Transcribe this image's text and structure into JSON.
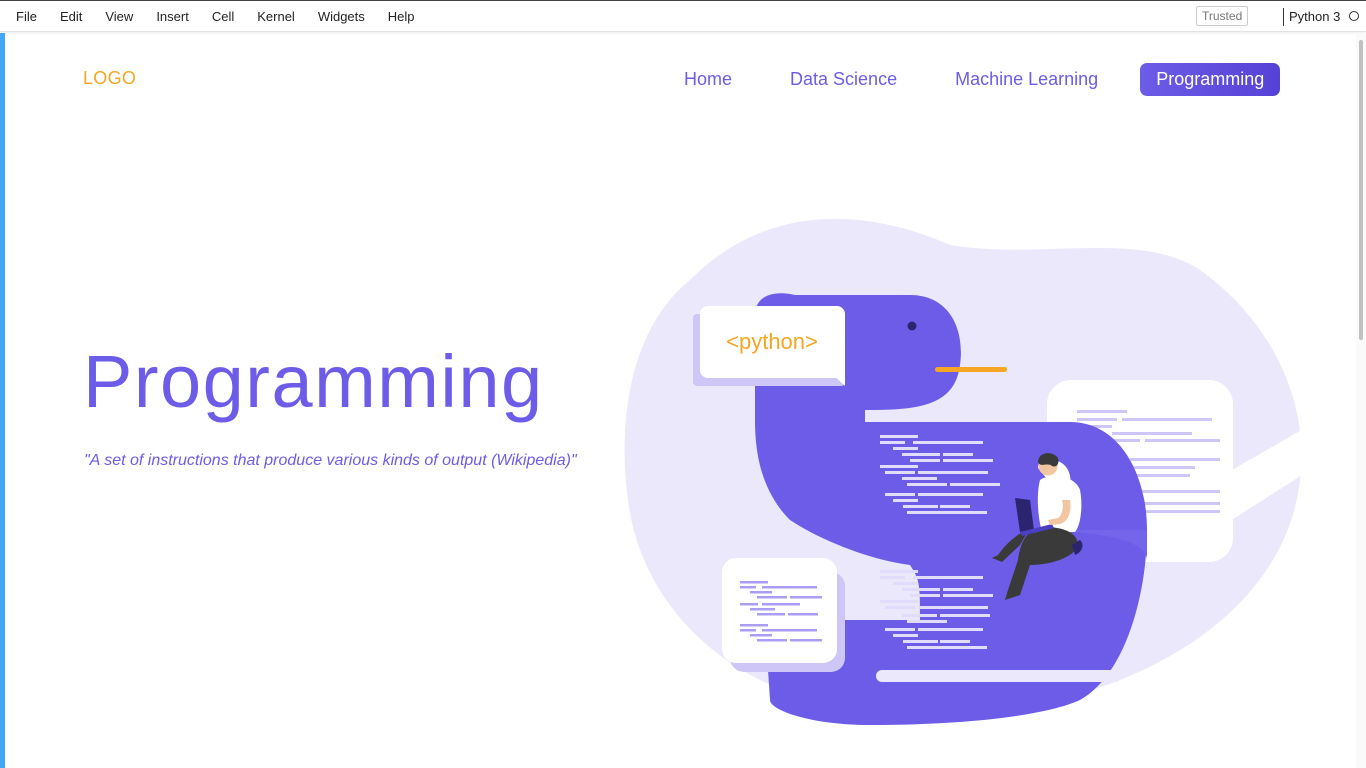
{
  "menubar": {
    "items": [
      "File",
      "Edit",
      "View",
      "Insert",
      "Cell",
      "Kernel",
      "Widgets",
      "Help"
    ],
    "trusted_label": "Trusted",
    "kernel_name": "Python 3"
  },
  "page": {
    "logo": "LOGO",
    "nav": {
      "items": [
        "Home",
        "Data Science",
        "Machine Learning",
        "Programming"
      ],
      "active": "Programming"
    },
    "hero": {
      "title": "Programming",
      "quote": "\"A set of instructions that produce various kinds of output (Wikipedia)\""
    },
    "illustration": {
      "badge_text": "<python>"
    }
  },
  "colors": {
    "accent": "#6c5ce7",
    "logo": "#f5a623",
    "blob": "#ebe8fc",
    "cell_bar": "#42a5f5"
  }
}
